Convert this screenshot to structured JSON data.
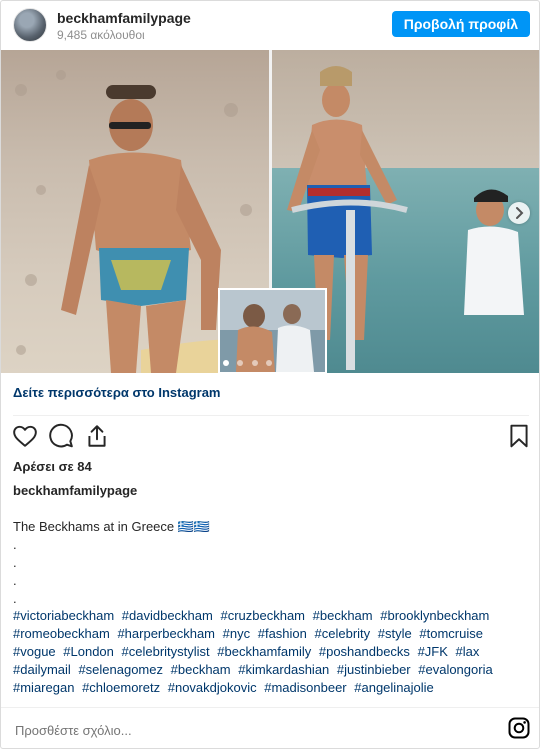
{
  "header": {
    "username": "beckhamfamilypage",
    "followers": "9,485 ακόλουθοι",
    "profile_button": "Προβολή προφίλ"
  },
  "media": {
    "carousel_dots": 4,
    "active_dot": 0
  },
  "see_more_label": "Δείτε περισσότερα στο Instagram",
  "likes": "Αρέσει σε 84",
  "caption": {
    "username": "beckhamfamilypage",
    "text": "The Beckhams at in Greece 🇬🇷🇬🇷",
    "dots": [
      ".",
      ".",
      ".",
      "."
    ],
    "hashtags": [
      "#victoriabeckham",
      "#davidbeckham",
      "#cruzbeckham",
      "#beckham",
      "#brooklynbeckham",
      "#romeobeckham",
      "#harperbeckham",
      "#nyc",
      "#fashion",
      "#celebrity",
      "#style",
      "#tomcruise",
      "#vogue",
      "#London",
      "#celebritystylist",
      "#beckhamfamily",
      "#poshandbecks",
      "#JFK",
      "#lax",
      "#dailymail",
      "#selenagomez",
      "#beckham",
      "#kimkardashian",
      "#justinbieber",
      "#evalongoria",
      "#miaregan",
      "#chloemoretz",
      "#novakdjokovic",
      "#madisonbeer",
      "#angelinajolie"
    ]
  },
  "comment": {
    "placeholder": "Προσθέστε σχόλιο..."
  },
  "icons": {
    "like": "heart-icon",
    "comment": "comment-icon",
    "share": "share-icon",
    "save": "bookmark-icon",
    "instagram": "instagram-icon"
  }
}
